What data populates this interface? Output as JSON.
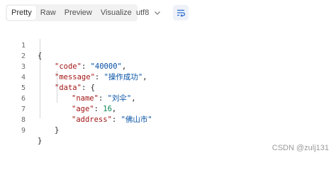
{
  "toolbar": {
    "tabs": [
      {
        "label": "Pretty",
        "active": true
      },
      {
        "label": "Raw",
        "active": false
      },
      {
        "label": "Preview",
        "active": false
      },
      {
        "label": "Visualize",
        "active": false
      }
    ],
    "encoding": "utf8",
    "wrap_icon": "wrap-lines-icon"
  },
  "editor": {
    "line_numbers": [
      "1",
      "2",
      "3",
      "4",
      "5",
      "6",
      "7",
      "8",
      "9"
    ],
    "lines": [
      {
        "open": "{"
      },
      {
        "key": "\"code\"",
        "colon": ": ",
        "value": "\"40000\"",
        "comma": ","
      },
      {
        "key": "\"message\"",
        "colon": ": ",
        "value": "\"操作成功\"",
        "comma": ","
      },
      {
        "key": "\"data\"",
        "colon": ": ",
        "value": "{"
      },
      {
        "key": "\"name\"",
        "colon": ": ",
        "value": "\"刘伞\"",
        "comma": ","
      },
      {
        "key": "\"age\"",
        "colon": ": ",
        "value": "16",
        "comma": ","
      },
      {
        "key": "\"address\"",
        "colon": ": ",
        "value": "\"佛山市\""
      },
      {
        "close": "}"
      },
      {
        "close": "}"
      }
    ]
  },
  "watermark": "CSDN @zulj131",
  "colors": {
    "key": "#a31515",
    "string": "#0451a5",
    "number": "#098658"
  }
}
